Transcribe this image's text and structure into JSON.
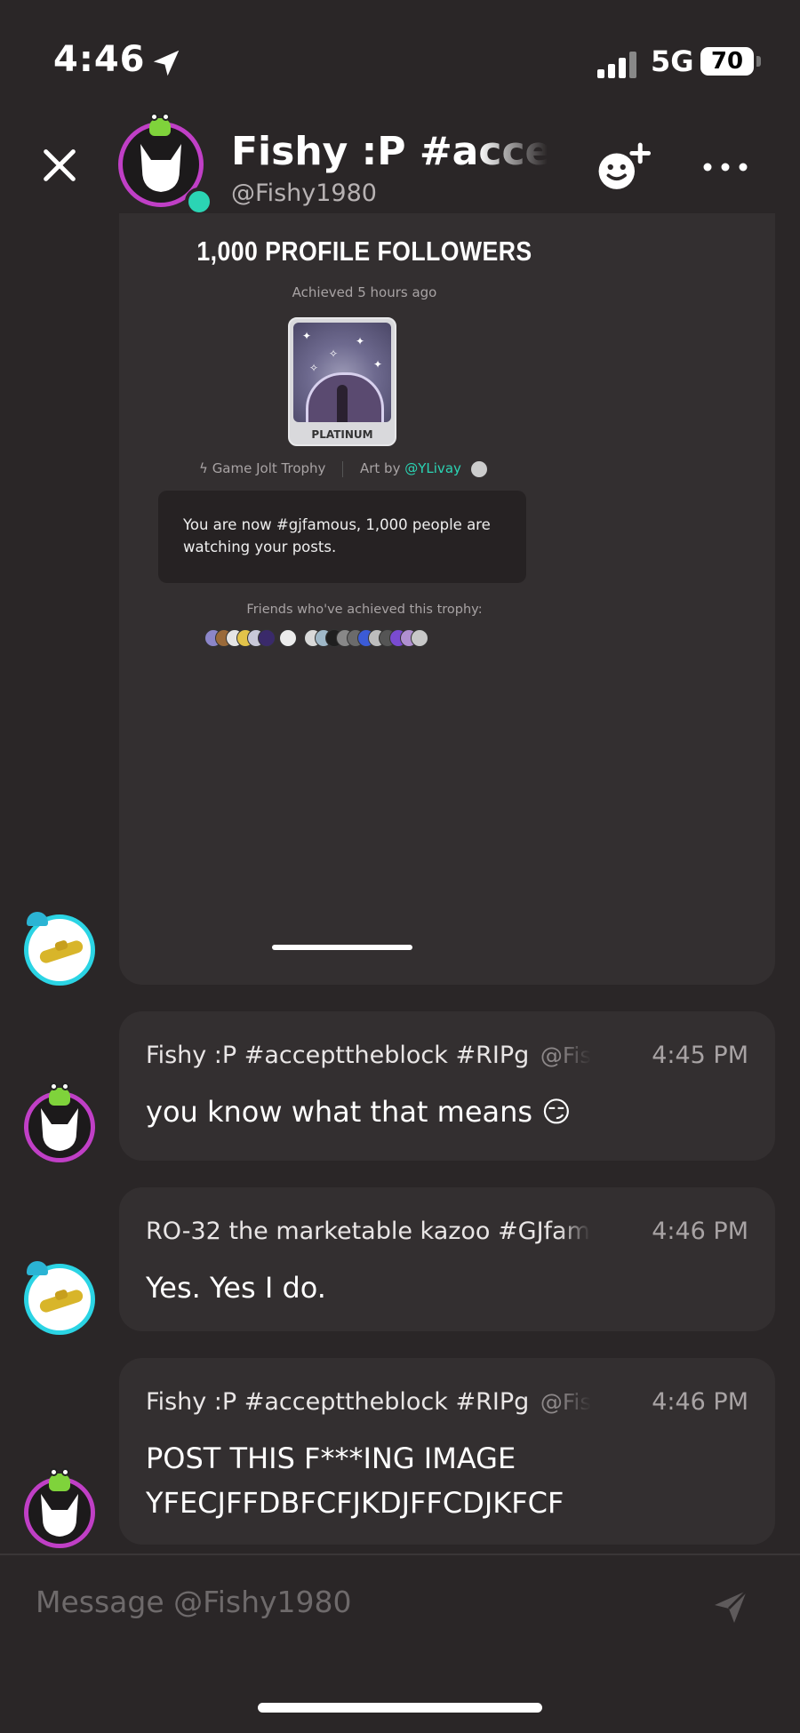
{
  "status_bar": {
    "time": "4:46",
    "network": "5G",
    "battery": "70"
  },
  "header": {
    "title": "Fishy :P #acceptt",
    "handle": "@Fishy1980"
  },
  "trophy": {
    "title": "1,000 PROFILE FOLLOWERS",
    "achieved": "Achieved 5 hours ago",
    "tier": "PLATINUM",
    "type": "Game Jolt Trophy",
    "art_by_label": "Art by",
    "art_by_user": "@YLivay",
    "description": "You are now #gjfamous, 1,000 people are watching your posts.",
    "friends_label": "Friends who've achieved this trophy:"
  },
  "messages": [
    {
      "author": "Fishy :P #accepttheblock #RIPg",
      "handle": "@Fis",
      "time": "4:45 PM",
      "body": "you know what that means 😏"
    },
    {
      "author": "RO-32 the marketable kazoo #GJfam",
      "handle": "",
      "time": "4:46 PM",
      "body": "Yes. Yes I do."
    },
    {
      "author": "Fishy :P #accepttheblock #RIPg",
      "handle": "@Fis",
      "time": "4:46 PM",
      "body_line1": "POST THIS F***ING IMAGE",
      "body_line2": "YFECJFFDBFCFJKDJFFCDJKFCF"
    }
  ],
  "composer": {
    "placeholder": "Message @Fishy1980"
  },
  "colors": {
    "accent_teal": "#2bd4b4",
    "avatar_ring_pink": "#c03fc6",
    "background": "#2a2627",
    "card": "#332f30"
  }
}
